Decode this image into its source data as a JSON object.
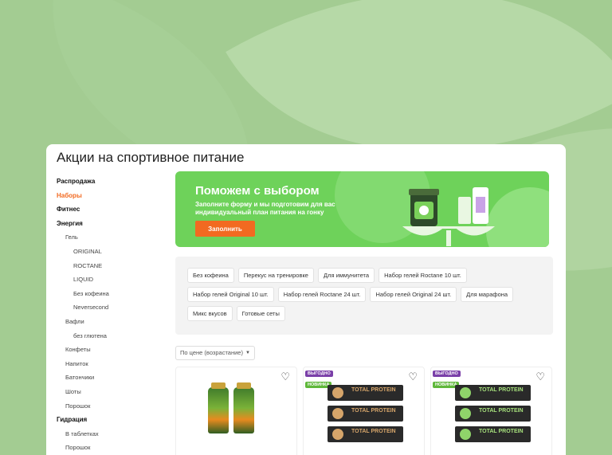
{
  "page": {
    "title": "Акции на спортивное питание"
  },
  "sidebar": {
    "items": [
      {
        "label": "Распродажа",
        "level": 0
      },
      {
        "label": "Наборы",
        "level": 0,
        "active": true
      },
      {
        "label": "Фитнес",
        "level": 0
      },
      {
        "label": "Энергия",
        "level": 0
      },
      {
        "label": "Гель",
        "level": 1
      },
      {
        "label": "ORIGINAL",
        "level": 2
      },
      {
        "label": "ROCTANE",
        "level": 2
      },
      {
        "label": "LIQUID",
        "level": 2
      },
      {
        "label": "Без кофеина",
        "level": 2
      },
      {
        "label": "Neversecond",
        "level": 2
      },
      {
        "label": "Вафли",
        "level": 1
      },
      {
        "label": "без глютена",
        "level": 2
      },
      {
        "label": "Конфеты",
        "level": 1
      },
      {
        "label": "Напиток",
        "level": 1
      },
      {
        "label": "Батончики",
        "level": 1
      },
      {
        "label": "Шоты",
        "level": 1
      },
      {
        "label": "Порошок",
        "level": 1
      },
      {
        "label": "Гидрация",
        "level": 0
      },
      {
        "label": "В таблетках",
        "level": 1
      },
      {
        "label": "Порошок",
        "level": 1
      }
    ]
  },
  "banner": {
    "title": "Поможем с выбором",
    "subtitle": "Заполните форму и мы подготовим для вас индивидуальный план питания на гонку",
    "button_label": "Заполнить"
  },
  "tags": [
    "Без кофеина",
    "Перекус на тренировке",
    "Для иммунитета",
    "Набор гелей Roctane 10 шт.",
    "Набор гелей Original 10 шт.",
    "Набор гелей Roctane 24 шт.",
    "Набор гелей Original 24 шт.",
    "Для марафона",
    "Микс вкусов",
    "Готовые сеты"
  ],
  "sort": {
    "selected": "По цене (возрастание)"
  },
  "products": [
    {
      "badges": []
    },
    {
      "badges": [
        "ВЫГОДНО",
        "НОВИНКА"
      ],
      "bar_text": "TOTAL PROTEIN"
    },
    {
      "badges": [
        "ВЫГОДНО",
        "НОВИНКА"
      ],
      "bar_text": "TOTAL PROTEIN"
    }
  ],
  "colors": {
    "accent": "#f26a21",
    "banner": "#6ed25a",
    "badge_vygodno": "#7a3fa8",
    "badge_novinka": "#5fb83a"
  },
  "icons": {
    "favorite": "heart-outline-icon",
    "dropdown": "chevron-down-icon"
  }
}
